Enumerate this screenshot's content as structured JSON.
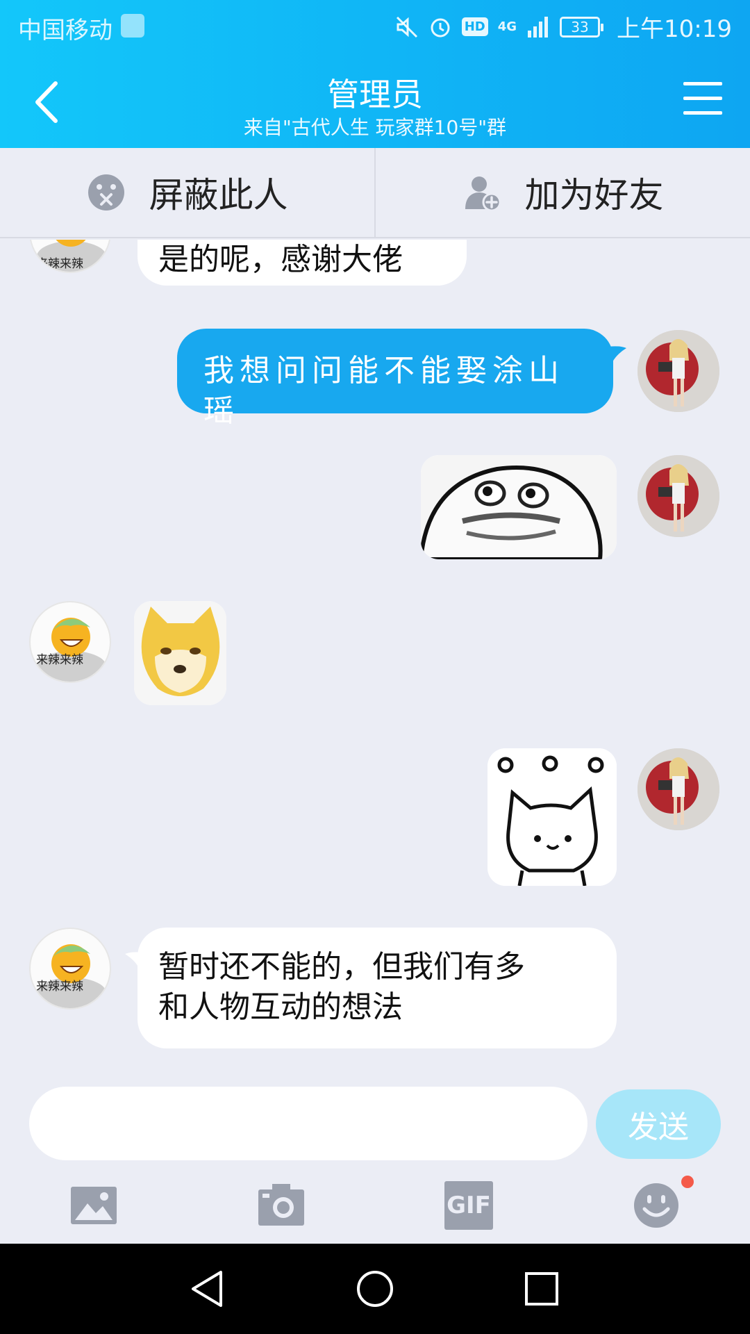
{
  "status_bar": {
    "carrier": "中国移动",
    "hd": "HD",
    "network": "4G",
    "battery": "33",
    "time": "上午10:19"
  },
  "header": {
    "title": "管理员",
    "subtitle": "来自\"古代人生 玩家群10号\"群"
  },
  "actions": {
    "block_label": "屏蔽此人",
    "add_friend_label": "加为好友"
  },
  "messages": [
    {
      "side": "left",
      "type": "text",
      "text": "是的呢，感谢大佬",
      "partial": true
    },
    {
      "side": "right",
      "type": "text",
      "text": "我想问问能不能娶涂山瑶"
    },
    {
      "side": "right",
      "type": "sticker",
      "sticker": "blob-face-sticker"
    },
    {
      "side": "left",
      "type": "sticker",
      "sticker": "doge-sticker"
    },
    {
      "side": "right",
      "type": "sticker",
      "sticker": "white-cat-sticker"
    },
    {
      "side": "left",
      "type": "text",
      "text_line1": "暂时还不能的，但我们有多",
      "text_line2": "和人物互动的想法"
    }
  ],
  "avatar_left_caption": "来辣来辣",
  "input": {
    "value": "",
    "placeholder": "",
    "send_label": "发送",
    "gif_label": "GIF"
  },
  "colors": {
    "header_start": "#13c7fa",
    "header_end": "#0ea6f2",
    "outgoing_bubble": "#18a8ef",
    "send_button_disabled": "#a7e6f9",
    "notification_dot": "#f45a49"
  },
  "icons": [
    "back-arrow-icon",
    "menu-icon",
    "block-icon",
    "add-friend-icon",
    "image-icon",
    "camera-icon",
    "gif-icon",
    "emoji-icon"
  ]
}
